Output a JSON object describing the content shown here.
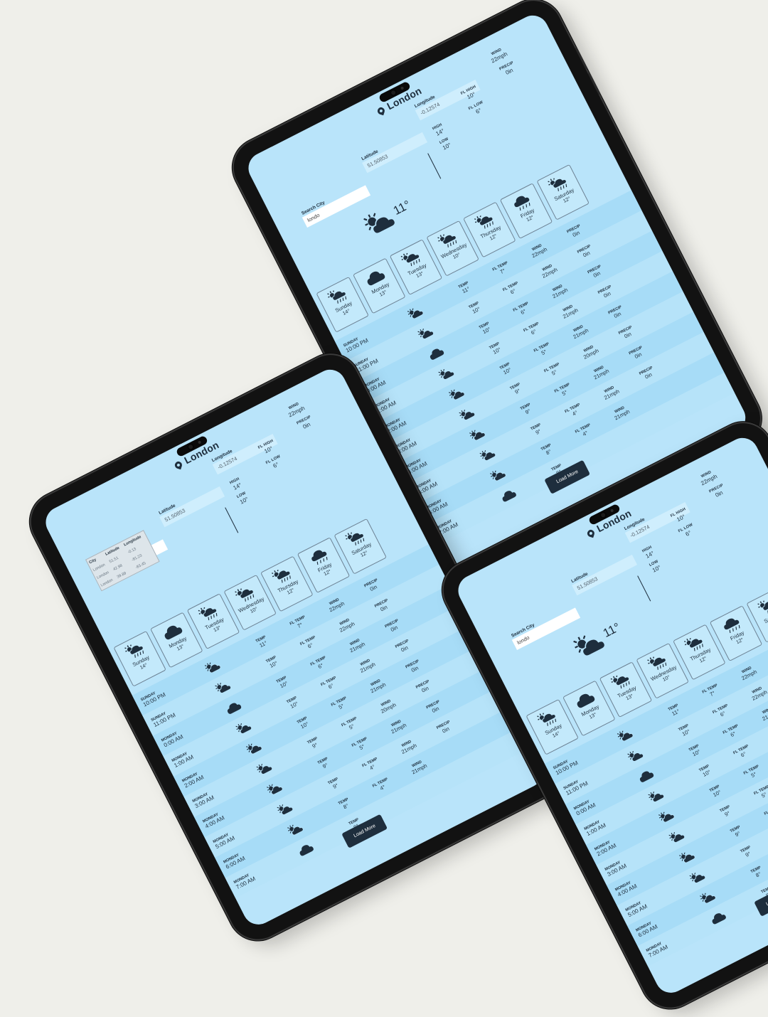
{
  "app": {
    "location_name": "London",
    "search": {
      "label": "Search City",
      "values": [
        "londo",
        "London",
        "londo"
      ]
    },
    "latitude": {
      "label": "Latitude",
      "value": "51.50853"
    },
    "longitude": {
      "label": "Longitude",
      "value": "-0.12574"
    },
    "current": {
      "temp": "11°",
      "icon": "partly-cloudy-icon"
    },
    "today": {
      "high_label": "HIGH",
      "high": "14°",
      "low_label": "LOW",
      "low": "10°",
      "fl_high_label": "FL HIGH",
      "fl_high": "10°",
      "fl_low_label": "FL LOW",
      "fl_low": "6°",
      "wind_label": "WIND",
      "wind": "22mph",
      "precip_label": "PRECIP",
      "precip": "0in"
    },
    "days": [
      {
        "name": "Sunday",
        "temp": "14°",
        "icon": "sun-rain-icon"
      },
      {
        "name": "Monday",
        "temp": "13°",
        "icon": "cloud-icon"
      },
      {
        "name": "Tuesday",
        "temp": "13°",
        "icon": "sun-rain-icon"
      },
      {
        "name": "Wednesday",
        "temp": "10°",
        "icon": "sun-rain-icon"
      },
      {
        "name": "Thursday",
        "temp": "12°",
        "icon": "sun-rain-icon"
      },
      {
        "name": "Friday",
        "temp": "12°",
        "icon": "rain-icon"
      },
      {
        "name": "Saturday",
        "temp": "12°",
        "icon": "sun-rain-icon"
      }
    ],
    "hourly_labels": {
      "temp": "TEMP",
      "fl_temp": "FL TEMP",
      "wind": "WIND",
      "precip": "PRECIP"
    },
    "hours": [
      {
        "day": "SUNDAY",
        "time": "10:00 PM",
        "icon": "partly-cloudy-icon",
        "temp": "11°",
        "fl_temp": "7°",
        "wind": "22mph",
        "precip": "0in"
      },
      {
        "day": "SUNDAY",
        "time": "11:00 PM",
        "icon": "partly-cloudy-icon",
        "temp": "10°",
        "fl_temp": "6°",
        "wind": "22mph",
        "precip": "0in"
      },
      {
        "day": "MONDAY",
        "time": "0:00 AM",
        "icon": "cloud-icon",
        "temp": "10°",
        "fl_temp": "6°",
        "wind": "21mph",
        "precip": "0in"
      },
      {
        "day": "MONDAY",
        "time": "1:00 AM",
        "icon": "partly-cloudy-icon",
        "temp": "10°",
        "fl_temp": "6°",
        "wind": "21mph",
        "precip": "0in"
      },
      {
        "day": "MONDAY",
        "time": "2:00 AM",
        "icon": "partly-cloudy-icon",
        "temp": "10°",
        "fl_temp": "5°",
        "wind": "21mph",
        "precip": "0in"
      },
      {
        "day": "MONDAY",
        "time": "3:00 AM",
        "icon": "partly-cloudy-icon",
        "temp": "9°",
        "fl_temp": "5°",
        "wind": "20mph",
        "precip": "0in"
      },
      {
        "day": "MONDAY",
        "time": "4:00 AM",
        "icon": "partly-cloudy-icon",
        "temp": "9°",
        "fl_temp": "5°",
        "wind": "21mph",
        "precip": "0in"
      },
      {
        "day": "MONDAY",
        "time": "5:00 AM",
        "icon": "partly-cloudy-icon",
        "temp": "9°",
        "fl_temp": "4°",
        "wind": "21mph",
        "precip": "0in"
      },
      {
        "day": "MONDAY",
        "time": "6:00 AM",
        "icon": "partly-cloudy-icon",
        "temp": "8°",
        "fl_temp": "4°",
        "wind": "21mph",
        "precip": ""
      },
      {
        "day": "MONDAY",
        "time": "7:00 AM",
        "icon": "cloud-icon",
        "temp": "8°",
        "fl_temp": "",
        "wind": "",
        "precip": ""
      }
    ],
    "load_more_label": "Load More",
    "dropdown": {
      "headers": [
        "City",
        "Latitude",
        "Longitude"
      ],
      "rows": [
        [
          "London",
          "51.51",
          "-0.13"
        ],
        [
          "London",
          "42.98",
          "-81.23"
        ],
        [
          "London",
          "39.89",
          "-83.45"
        ]
      ]
    }
  },
  "colors": {
    "page_bg": "#efefea",
    "screen_bg": "#b9e4fa",
    "ink": "#1e2e3d",
    "bezel": "#121212"
  }
}
